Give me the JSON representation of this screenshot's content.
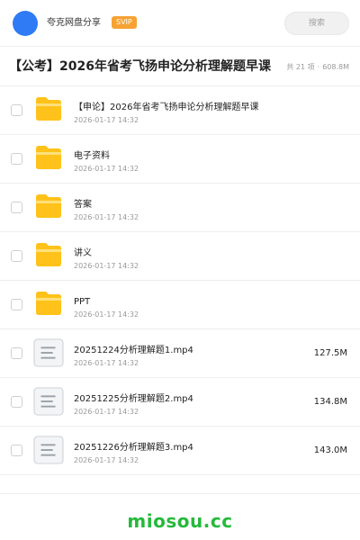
{
  "header": {
    "username": "夸克网盘分享",
    "badge": "SVIP",
    "search_placeholder": "搜索"
  },
  "folder": {
    "title": "【公考】2026年省考飞扬申论分析理解题早课",
    "item_count": "共 21 项",
    "total_size": "608.8M"
  },
  "files": [
    {
      "name": "【申论】2026年省考飞扬申论分析理解题早课",
      "date": "2026-01-17 14:32",
      "size": "",
      "icon": "folder-icon"
    },
    {
      "name": "电子资料",
      "date": "2026-01-17 14:32",
      "size": "",
      "icon": "folder-icon"
    },
    {
      "name": "答案",
      "date": "2026-01-17 14:32",
      "size": "",
      "icon": "folder-icon"
    },
    {
      "name": "讲义",
      "date": "2026-01-17 14:32",
      "size": "",
      "icon": "folder-icon"
    },
    {
      "name": "PPT",
      "date": "2026-01-17 14:32",
      "size": "",
      "icon": "folder-icon"
    },
    {
      "name": "20251224分析理解题1.mp4",
      "date": "2026-01-17 14:32",
      "size": "127.5M",
      "icon": "file-icon"
    },
    {
      "name": "20251225分析理解题2.mp4",
      "date": "2026-01-17 14:32",
      "size": "134.8M",
      "icon": "file-icon"
    },
    {
      "name": "20251226分析理解题3.mp4",
      "date": "2026-01-17 14:32",
      "size": "143.0M",
      "icon": "file-icon"
    }
  ],
  "footer": {
    "brand": "miosou.cc"
  },
  "colors": {
    "accent_blue": "#2f7bf5",
    "svip_orange": "#f7a233",
    "folder_yellow": "#ffc21a",
    "brand_green": "#25b93b"
  }
}
